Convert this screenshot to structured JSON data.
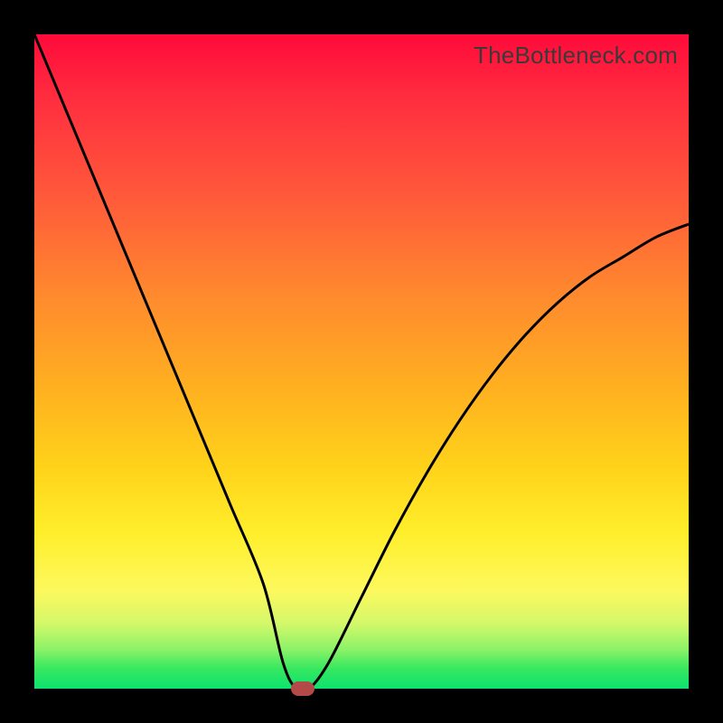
{
  "watermark": "TheBottleneck.com",
  "colors": {
    "frame": "#000000",
    "curve_stroke": "#000000",
    "marker": "#b34a47",
    "gradient_stops": [
      "#ff0a3a",
      "#ff5a3a",
      "#ffb020",
      "#ffee2a",
      "#8cf268",
      "#0de26f"
    ]
  },
  "chart_data": {
    "type": "line",
    "title": "",
    "xlabel": "",
    "ylabel": "",
    "xlim": [
      0,
      100
    ],
    "ylim": [
      0,
      100
    ],
    "grid": false,
    "legend": false,
    "series": [
      {
        "name": "bottleneck-curve",
        "x": [
          0,
          5,
          10,
          15,
          20,
          25,
          30,
          35,
          38,
          40,
          42,
          45,
          50,
          55,
          60,
          65,
          70,
          75,
          80,
          85,
          90,
          95,
          100
        ],
        "y": [
          100,
          88,
          76,
          64,
          52,
          40,
          28,
          16,
          4,
          0,
          0,
          4,
          14,
          24,
          33,
          41,
          48,
          54,
          59,
          63,
          66,
          69,
          71
        ]
      }
    ],
    "annotations": [
      {
        "name": "optimal-marker",
        "x": 41,
        "y": 0
      }
    ]
  }
}
